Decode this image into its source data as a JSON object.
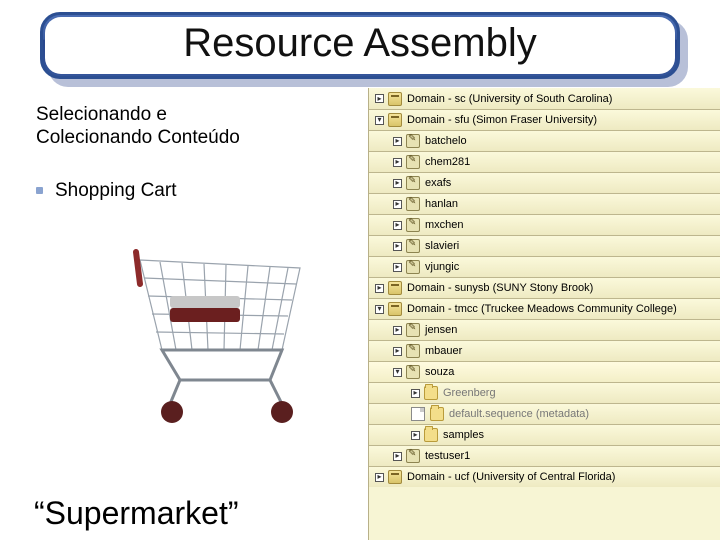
{
  "title": "Resource Assembly",
  "subtitle_line1": "Selecionando e",
  "subtitle_line2": "Colecionando Conteúdo",
  "bullet": "Shopping Cart",
  "footer": "“Supermarket”",
  "tree": {
    "r0": {
      "label": "Domain - sc (University of South Carolina)"
    },
    "r1": {
      "label": "Domain - sfu (Simon Fraser University)"
    },
    "r2": {
      "label": "batchelo"
    },
    "r3": {
      "label": "chem281"
    },
    "r4": {
      "label": "exafs"
    },
    "r5": {
      "label": "hanlan"
    },
    "r6": {
      "label": "mxchen"
    },
    "r7": {
      "label": "slavieri"
    },
    "r8": {
      "label": "vjungic"
    },
    "r9": {
      "label": "Domain - sunysb (SUNY Stony Brook)"
    },
    "r10": {
      "label": "Domain - tmcc (Truckee Meadows Community College)"
    },
    "r11": {
      "label": "jensen"
    },
    "r12": {
      "label": "mbauer"
    },
    "r13": {
      "label": "souza"
    },
    "r14": {
      "label": "Greenberg"
    },
    "r15": {
      "label": "default.sequence (metadata)"
    },
    "r16": {
      "label": "samples"
    },
    "r17": {
      "label": "testuser1"
    },
    "r18": {
      "label": "Domain - ucf (University of Central Florida)"
    }
  }
}
